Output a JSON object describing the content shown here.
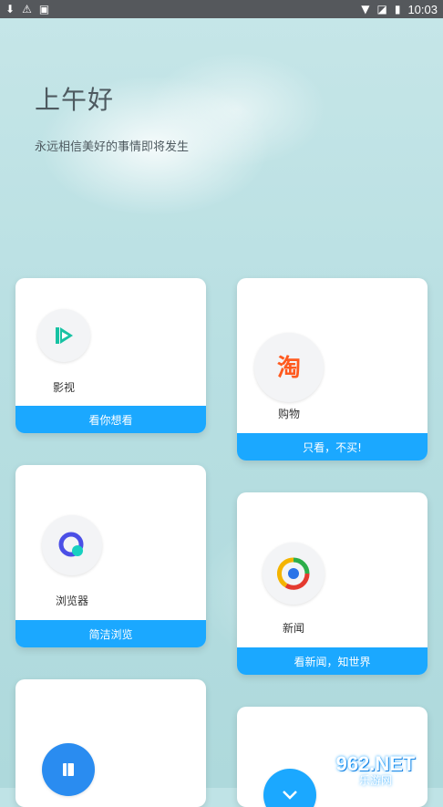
{
  "status_bar": {
    "time": "10:03"
  },
  "header": {
    "greeting": "上午好",
    "motto": "永远相信美好的事情即将发生"
  },
  "cards": [
    {
      "label": "影视",
      "footer": "看你想看"
    },
    {
      "label": "购物",
      "footer": "只看，不买!"
    },
    {
      "label": "浏览器",
      "footer": "简洁浏览"
    },
    {
      "label": "新闻",
      "footer": "看新闻，知世界"
    }
  ],
  "icons": {
    "video": "video-play-icon",
    "taobao": "taobao-icon",
    "browser": "browser-icon",
    "news": "news-icon",
    "book": "book-icon",
    "chevron": "chevron-icon"
  },
  "watermark": {
    "number": "962.NET",
    "subtitle": "乐游网"
  },
  "colors": {
    "accent": "#1ba8ff",
    "shop": "#ff5a1f",
    "video": "#17c2a3"
  }
}
